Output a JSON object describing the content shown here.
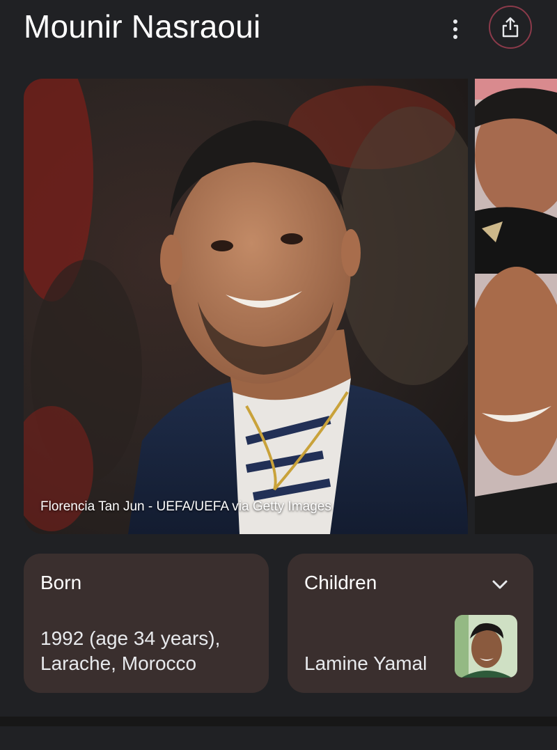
{
  "header": {
    "title": "Mounir Nasraoui",
    "more_icon": "more-vert-icon",
    "share_icon": "share-icon"
  },
  "images": {
    "main_caption": "Florencia Tan Jun - UEFA/UEFA via Getty Images"
  },
  "facts": {
    "born": {
      "label": "Born",
      "value": "1992 (age 34 years), Larache, Morocco"
    },
    "children": {
      "label": "Children",
      "value": "Lamine Yamal",
      "expand_icon": "chevron-down-icon"
    }
  },
  "colors": {
    "background": "#202124",
    "card": "#3a2f2e",
    "share_ring": "#8b3a4a"
  }
}
